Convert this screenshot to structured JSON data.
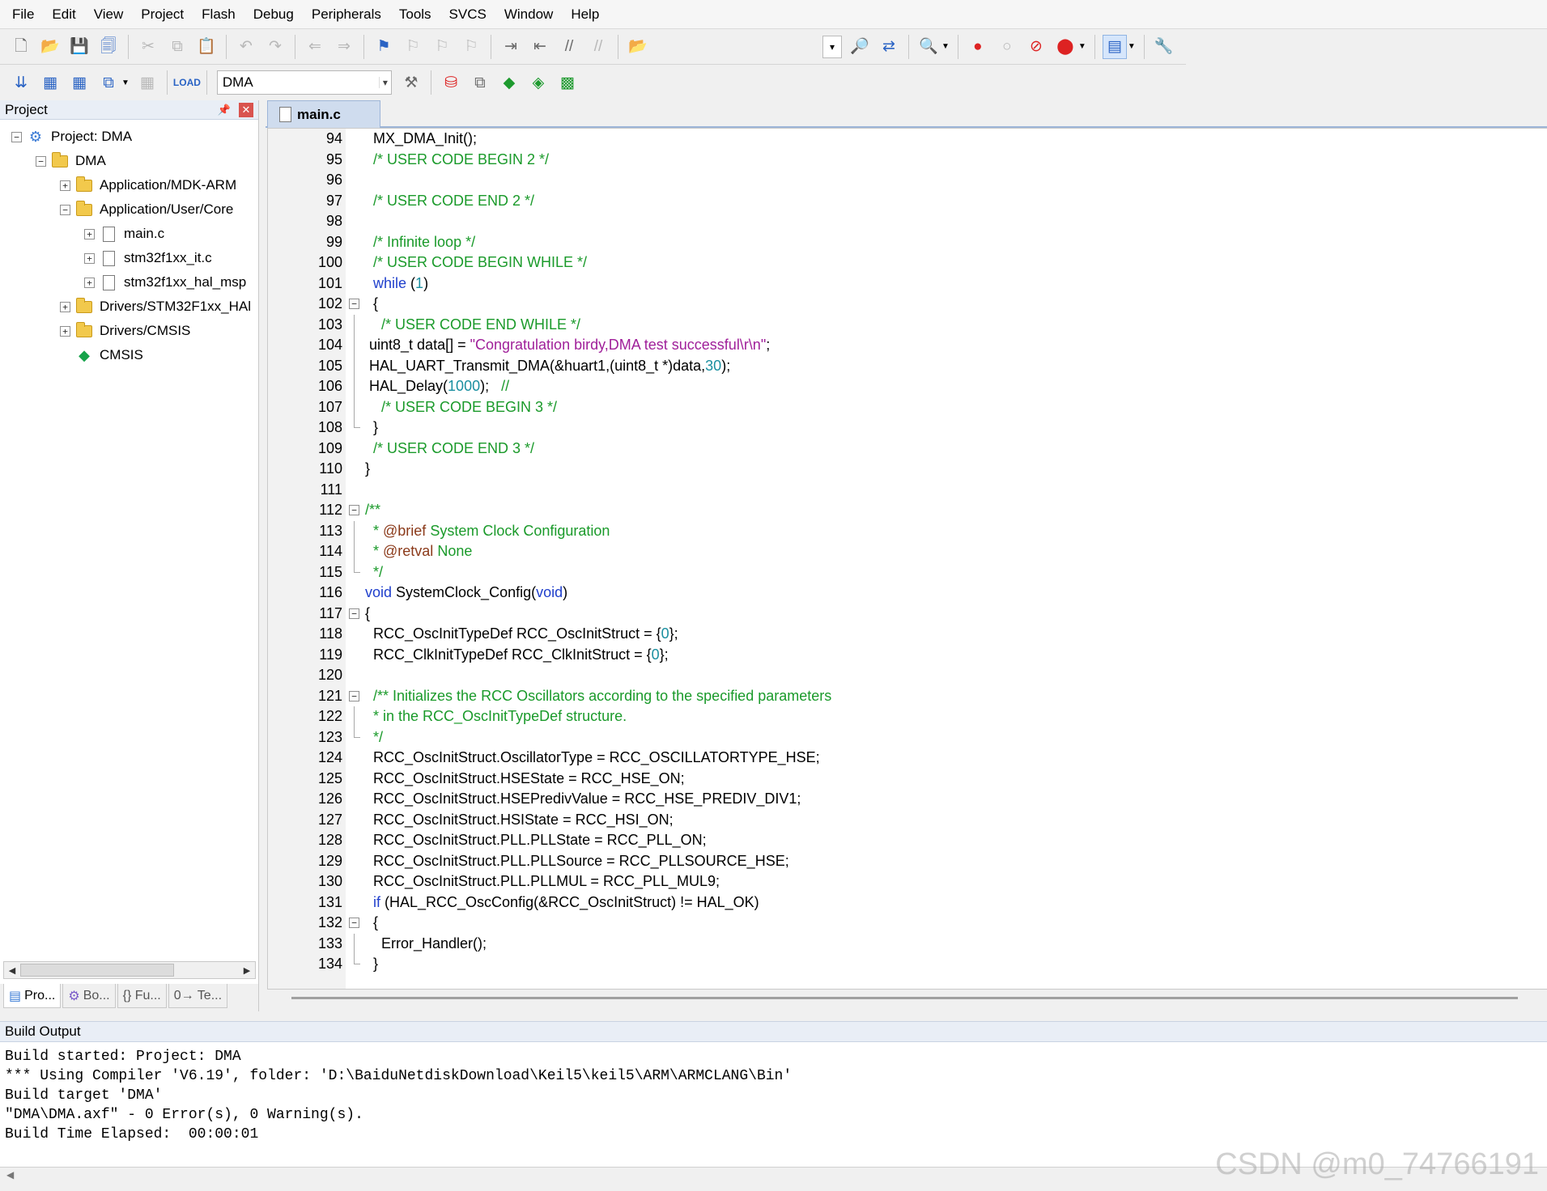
{
  "menu": [
    "File",
    "Edit",
    "View",
    "Project",
    "Flash",
    "Debug",
    "Peripherals",
    "Tools",
    "SVCS",
    "Window",
    "Help"
  ],
  "toolbar2": {
    "target": "DMA"
  },
  "project_panel": {
    "title": "Project",
    "tree": [
      {
        "label": "Project: DMA"
      },
      {
        "label": "DMA"
      },
      {
        "label": "Application/MDK-ARM"
      },
      {
        "label": "Application/User/Core"
      },
      {
        "label": "main.c"
      },
      {
        "label": "stm32f1xx_it.c"
      },
      {
        "label": "stm32f1xx_hal_msp"
      },
      {
        "label": "Drivers/STM32F1xx_HAl"
      },
      {
        "label": "Drivers/CMSIS"
      },
      {
        "label": "CMSIS"
      }
    ],
    "tabs": [
      "Pro...",
      "Bo...",
      "{} Fu...",
      "0→ Te..."
    ]
  },
  "editor": {
    "tab": "main.c",
    "lines": [
      {
        "n": "94",
        "segs": [
          {
            "t": "  MX_DMA_Init();",
            "c": ""
          }
        ]
      },
      {
        "n": "95",
        "segs": [
          {
            "t": "  /* USER CODE BEGIN 2 */",
            "c": "cmt"
          }
        ]
      },
      {
        "n": "96",
        "segs": []
      },
      {
        "n": "97",
        "segs": [
          {
            "t": "  /* USER CODE END 2 */",
            "c": "cmt"
          }
        ]
      },
      {
        "n": "98",
        "segs": []
      },
      {
        "n": "99",
        "segs": [
          {
            "t": "  /* Infinite loop */",
            "c": "cmt"
          }
        ]
      },
      {
        "n": "100",
        "segs": [
          {
            "t": "  /* USER CODE BEGIN WHILE */",
            "c": "cmt"
          }
        ]
      },
      {
        "n": "101",
        "segs": [
          {
            "t": "  ",
            "c": ""
          },
          {
            "t": "while",
            "c": "kw"
          },
          {
            "t": " (",
            "c": ""
          },
          {
            "t": "1",
            "c": "num"
          },
          {
            "t": ")",
            "c": ""
          }
        ]
      },
      {
        "n": "102",
        "segs": [
          {
            "t": "  {",
            "c": ""
          }
        ]
      },
      {
        "n": "103",
        "segs": [
          {
            "t": "    /* USER CODE END WHILE */",
            "c": "cmt"
          }
        ]
      },
      {
        "n": "104",
        "segs": [
          {
            "t": " uint8_t data[] = ",
            "c": ""
          },
          {
            "t": "\"Congratulation birdy,DMA test successful\\r\\n\"",
            "c": "str"
          },
          {
            "t": ";",
            "c": ""
          }
        ]
      },
      {
        "n": "105",
        "segs": [
          {
            "t": " HAL_UART_Transmit_DMA(&huart1,(uint8_t *)data,",
            "c": ""
          },
          {
            "t": "30",
            "c": "num"
          },
          {
            "t": ");",
            "c": ""
          }
        ]
      },
      {
        "n": "106",
        "segs": [
          {
            "t": " HAL_Delay(",
            "c": ""
          },
          {
            "t": "1000",
            "c": "num"
          },
          {
            "t": ");   ",
            "c": ""
          },
          {
            "t": "//",
            "c": "cmt"
          }
        ]
      },
      {
        "n": "107",
        "segs": [
          {
            "t": "    /* USER CODE BEGIN 3 */",
            "c": "cmt"
          }
        ]
      },
      {
        "n": "108",
        "segs": [
          {
            "t": "  }",
            "c": ""
          }
        ]
      },
      {
        "n": "109",
        "segs": [
          {
            "t": "  /* USER CODE END 3 */",
            "c": "cmt"
          }
        ]
      },
      {
        "n": "110",
        "segs": [
          {
            "t": "}",
            "c": ""
          }
        ]
      },
      {
        "n": "111",
        "segs": []
      },
      {
        "n": "112",
        "segs": [
          {
            "t": "/**",
            "c": "cmt"
          }
        ]
      },
      {
        "n": "113",
        "segs": [
          {
            "t": "  * ",
            "c": "cmt"
          },
          {
            "t": "@brief",
            "c": "doc"
          },
          {
            "t": " System Clock Configuration",
            "c": "cmt"
          }
        ]
      },
      {
        "n": "114",
        "segs": [
          {
            "t": "  * ",
            "c": "cmt"
          },
          {
            "t": "@retval",
            "c": "doc"
          },
          {
            "t": " None",
            "c": "cmt"
          }
        ]
      },
      {
        "n": "115",
        "segs": [
          {
            "t": "  */",
            "c": "cmt"
          }
        ]
      },
      {
        "n": "116",
        "segs": [
          {
            "t": "void",
            "c": "kw"
          },
          {
            "t": " SystemClock_Config(",
            "c": ""
          },
          {
            "t": "void",
            "c": "kw"
          },
          {
            "t": ")",
            "c": ""
          }
        ]
      },
      {
        "n": "117",
        "segs": [
          {
            "t": "{",
            "c": ""
          }
        ]
      },
      {
        "n": "118",
        "segs": [
          {
            "t": "  RCC_OscInitTypeDef RCC_OscInitStruct = {",
            "c": ""
          },
          {
            "t": "0",
            "c": "num"
          },
          {
            "t": "};",
            "c": ""
          }
        ]
      },
      {
        "n": "119",
        "segs": [
          {
            "t": "  RCC_ClkInitTypeDef RCC_ClkInitStruct = {",
            "c": ""
          },
          {
            "t": "0",
            "c": "num"
          },
          {
            "t": "};",
            "c": ""
          }
        ]
      },
      {
        "n": "120",
        "segs": []
      },
      {
        "n": "121",
        "segs": [
          {
            "t": "  /** Initializes the RCC Oscillators according to the specified parameters",
            "c": "cmt"
          }
        ]
      },
      {
        "n": "122",
        "segs": [
          {
            "t": "  * in the RCC_OscInitTypeDef structure.",
            "c": "cmt"
          }
        ]
      },
      {
        "n": "123",
        "segs": [
          {
            "t": "  */",
            "c": "cmt"
          }
        ]
      },
      {
        "n": "124",
        "segs": [
          {
            "t": "  RCC_OscInitStruct.OscillatorType = RCC_OSCILLATORTYPE_HSE;",
            "c": ""
          }
        ]
      },
      {
        "n": "125",
        "segs": [
          {
            "t": "  RCC_OscInitStruct.HSEState = RCC_HSE_ON;",
            "c": ""
          }
        ]
      },
      {
        "n": "126",
        "segs": [
          {
            "t": "  RCC_OscInitStruct.HSEPredivValue = RCC_HSE_PREDIV_DIV1;",
            "c": ""
          }
        ]
      },
      {
        "n": "127",
        "segs": [
          {
            "t": "  RCC_OscInitStruct.HSIState = RCC_HSI_ON;",
            "c": ""
          }
        ]
      },
      {
        "n": "128",
        "segs": [
          {
            "t": "  RCC_OscInitStruct.PLL.PLLState = RCC_PLL_ON;",
            "c": ""
          }
        ]
      },
      {
        "n": "129",
        "segs": [
          {
            "t": "  RCC_OscInitStruct.PLL.PLLSource = RCC_PLLSOURCE_HSE;",
            "c": ""
          }
        ]
      },
      {
        "n": "130",
        "segs": [
          {
            "t": "  RCC_OscInitStruct.PLL.PLLMUL = RCC_PLL_MUL9;",
            "c": ""
          }
        ]
      },
      {
        "n": "131",
        "segs": [
          {
            "t": "  ",
            "c": ""
          },
          {
            "t": "if",
            "c": "kw"
          },
          {
            "t": " (HAL_RCC_OscConfig(&RCC_OscInitStruct) != HAL_OK)",
            "c": ""
          }
        ]
      },
      {
        "n": "132",
        "segs": [
          {
            "t": "  {",
            "c": ""
          }
        ]
      },
      {
        "n": "133",
        "segs": [
          {
            "t": "    Error_Handler();",
            "c": ""
          }
        ]
      },
      {
        "n": "134",
        "segs": [
          {
            "t": "  }",
            "c": ""
          }
        ]
      }
    ]
  },
  "build_output": {
    "title": "Build Output",
    "lines": [
      "Build started: Project: DMA",
      "*** Using Compiler 'V6.19', folder: 'D:\\BaiduNetdiskDownload\\Keil5\\keil5\\ARM\\ARMCLANG\\Bin'",
      "Build target 'DMA'",
      "\"DMA\\DMA.axf\" - 0 Error(s), 0 Warning(s).",
      "Build Time Elapsed:  00:00:01"
    ]
  },
  "watermark": "CSDN @m0_74766191"
}
